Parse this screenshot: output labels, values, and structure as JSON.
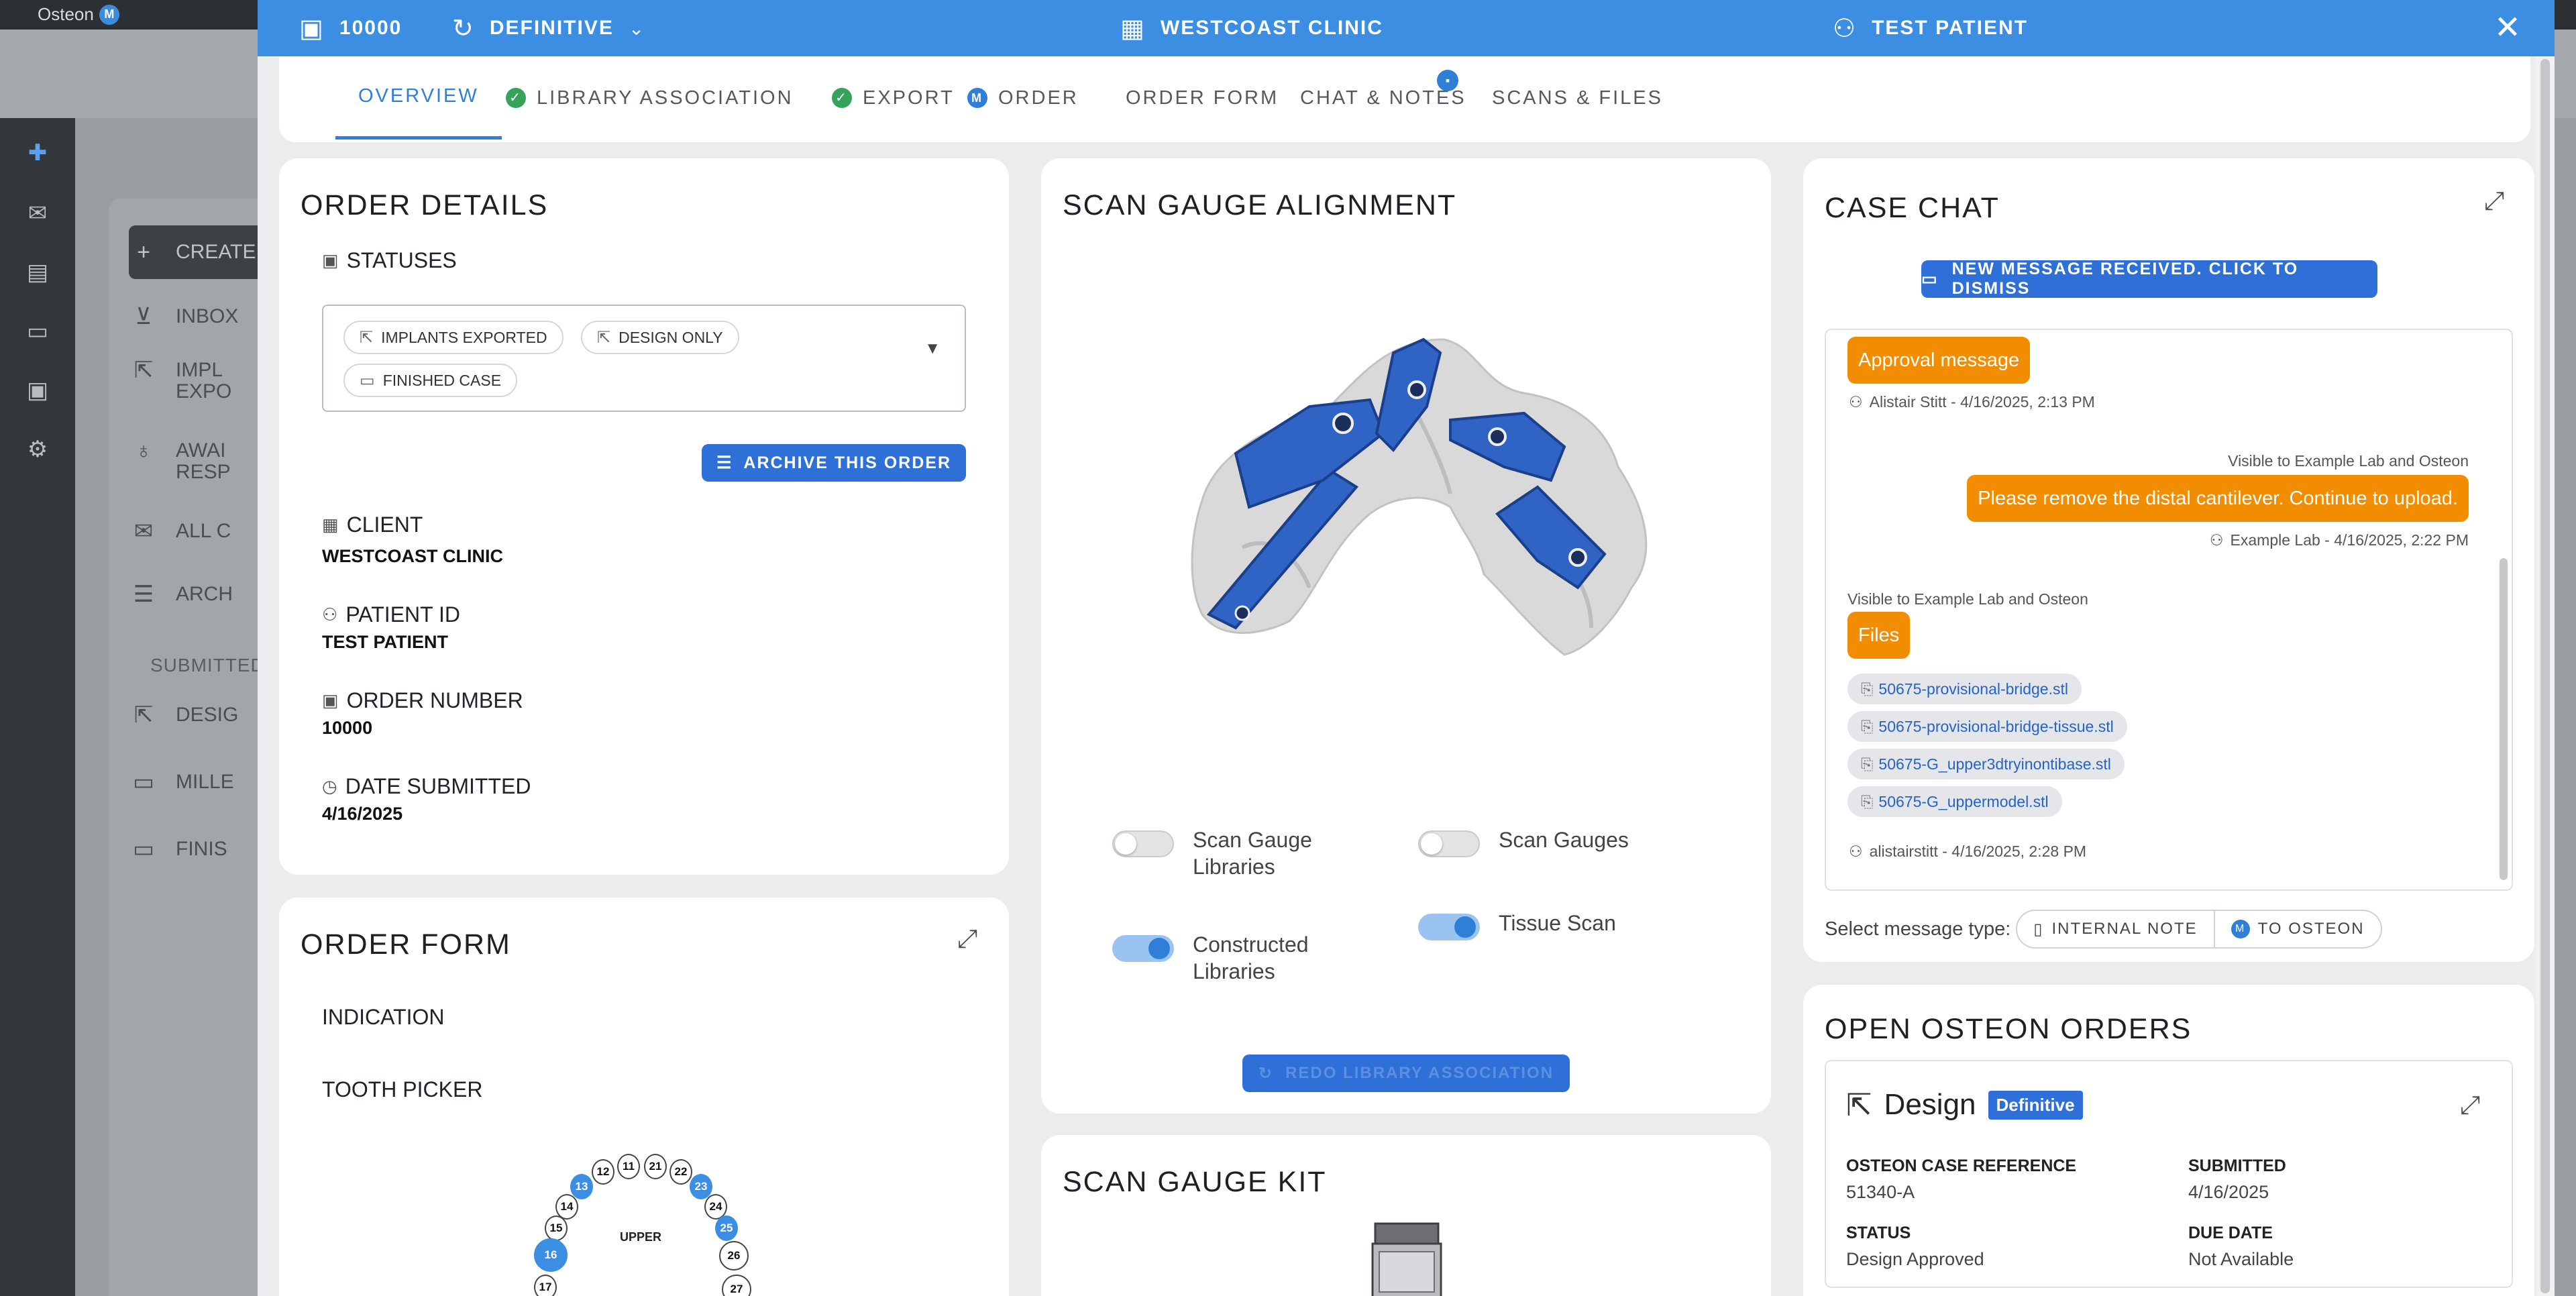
{
  "background": {
    "app_name": "Osteon",
    "logo_badge": "M",
    "nav": {
      "create": "CREATE",
      "inbox": "INBOX",
      "implants_exported_1": "IMPL",
      "implants_exported_2": "EXPO",
      "awaiting_1": "AWAI",
      "awaiting_2": "RESP",
      "all": "ALL C",
      "archived": "ARCH",
      "submitted_section": "SUBMITTED",
      "design": "DESIG",
      "milled": "MILLE",
      "finished": "FINIS"
    }
  },
  "header": {
    "order_number": "10000",
    "order_type": "DEFINITIVE",
    "clinic": "WESTCOAST CLINIC",
    "patient": "TEST PATIENT"
  },
  "tabs": [
    {
      "label": "OVERVIEW"
    },
    {
      "label": "LIBRARY ASSOCIATION"
    },
    {
      "label": "EXPORT"
    },
    {
      "label": "ORDER"
    },
    {
      "label": "ORDER FORM"
    },
    {
      "label": "CHAT & NOTES"
    },
    {
      "label": "SCANS & FILES"
    }
  ],
  "order_details": {
    "title": "ORDER DETAILS",
    "statuses_label": "STATUSES",
    "statuses": [
      "IMPLANTS EXPORTED",
      "DESIGN ONLY",
      "FINISHED CASE"
    ],
    "archive_button": "ARCHIVE THIS ORDER",
    "client_label": "CLIENT",
    "client_value": "WESTCOAST CLINIC",
    "patient_id_label": "PATIENT ID",
    "patient_id_value": "TEST PATIENT",
    "order_number_label": "ORDER NUMBER",
    "order_number_value": "10000",
    "date_submitted_label": "DATE SUBMITTED",
    "date_submitted_value": "4/16/2025"
  },
  "order_form": {
    "title": "ORDER FORM",
    "indication_label": "INDICATION",
    "tooth_picker_label": "TOOTH PICKER",
    "arch_label": "UPPER",
    "teeth": [
      "11",
      "12",
      "13",
      "14",
      "15",
      "16",
      "17",
      "21",
      "22",
      "23",
      "24",
      "25",
      "26",
      "27"
    ],
    "selected_teeth": [
      "13",
      "16",
      "23",
      "25"
    ]
  },
  "scan_gauge_alignment": {
    "title": "SCAN GAUGE ALIGNMENT",
    "toggles": {
      "scan_gauge_libraries": {
        "label": "Scan Gauge Libraries",
        "on": false
      },
      "scan_gauges": {
        "label": "Scan Gauges",
        "on": false
      },
      "constructed_libraries": {
        "label": "Constructed Libraries",
        "on": true
      },
      "tissue_scan": {
        "label": "Tissue Scan",
        "on": true
      }
    },
    "redo_button": "REDO LIBRARY ASSOCIATION",
    "colors": {
      "gauge": "#2f63c4",
      "tissue": "#d9d9d9"
    }
  },
  "scan_gauge_kit": {
    "title": "SCAN GAUGE KIT"
  },
  "case_chat": {
    "title": "CASE CHAT",
    "notice_button": "NEW MESSAGE RECEIVED. CLICK TO DISMISS",
    "messages": [
      {
        "text": "Approval message",
        "meta": "Alistair Stitt - 4/16/2025, 2:13 PM"
      },
      {
        "visibility": "Visible to Example Lab and Osteon",
        "text": "Please remove the distal cantilever. Continue to upload.",
        "meta": "Example Lab - 4/16/2025, 2:22 PM"
      },
      {
        "visibility": "Visible to Example Lab and Osteon",
        "text": "Files",
        "meta": "alistairstitt - 4/16/2025, 2:28 PM"
      }
    ],
    "files": [
      "50675-provisional-bridge.stl",
      "50675-provisional-bridge-tissue.stl",
      "50675-G_upper3dtryinontibase.stl",
      "50675-G_uppermodel.stl"
    ],
    "message_type_label": "Select message type:",
    "message_types": [
      "INTERNAL NOTE",
      "TO OSTEON"
    ]
  },
  "open_orders": {
    "title": "OPEN OSTEON ORDERS",
    "order_name": "Design",
    "order_badge": "Definitive",
    "case_ref_label": "OSTEON CASE REFERENCE",
    "case_ref_value": "51340-A",
    "submitted_label": "SUBMITTED",
    "submitted_value": "4/16/2025",
    "status_label": "STATUS",
    "status_value": "Design Approved",
    "due_label": "DUE DATE",
    "due_value": "Not Available"
  }
}
